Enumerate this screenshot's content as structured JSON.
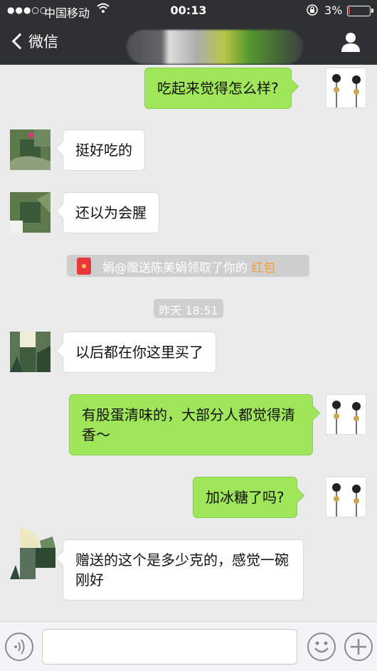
{
  "status_bar": {
    "signal": "●●●○○",
    "carrier": "中国移动",
    "wifi_icon": "wifi-icon",
    "time": "00:13",
    "battery_percent": "3%",
    "battery_level": 0.03,
    "battery_color": "#e03a3a"
  },
  "nav": {
    "back_label": "微信",
    "profile_icon": "person-icon"
  },
  "messages": [
    {
      "side": "out",
      "text": "吃起来觉得怎么样?"
    },
    {
      "side": "in",
      "text": "挺好吃的"
    },
    {
      "side": "in",
      "text": "还以为会腥"
    },
    {
      "side": "system",
      "text": "娟@赠送陈美娟领取了你的 ",
      "highlight": "红包",
      "icon": "red-packet-icon"
    },
    {
      "side": "time",
      "text": "昨天 18:51"
    },
    {
      "side": "in",
      "text": "以后都在你这里买了"
    },
    {
      "side": "out",
      "text": "有股蛋清味的，大部分人都觉得清香～"
    },
    {
      "side": "out",
      "text": "加冰糖了吗?"
    },
    {
      "side": "in",
      "text": "赠送的这个是多少克的，感觉一碗刚好"
    }
  ],
  "input_bar": {
    "voice_icon": "voice-icon",
    "emoji_icon": "emoji-icon",
    "plus_icon": "plus-icon",
    "text_value": ""
  },
  "colors": {
    "outgoing_bubble": "#9fe65a",
    "incoming_bubble": "#ffffff",
    "header_bg": "#2e3132",
    "chat_bg": "#ebebeb",
    "highlight": "#f79d35"
  }
}
